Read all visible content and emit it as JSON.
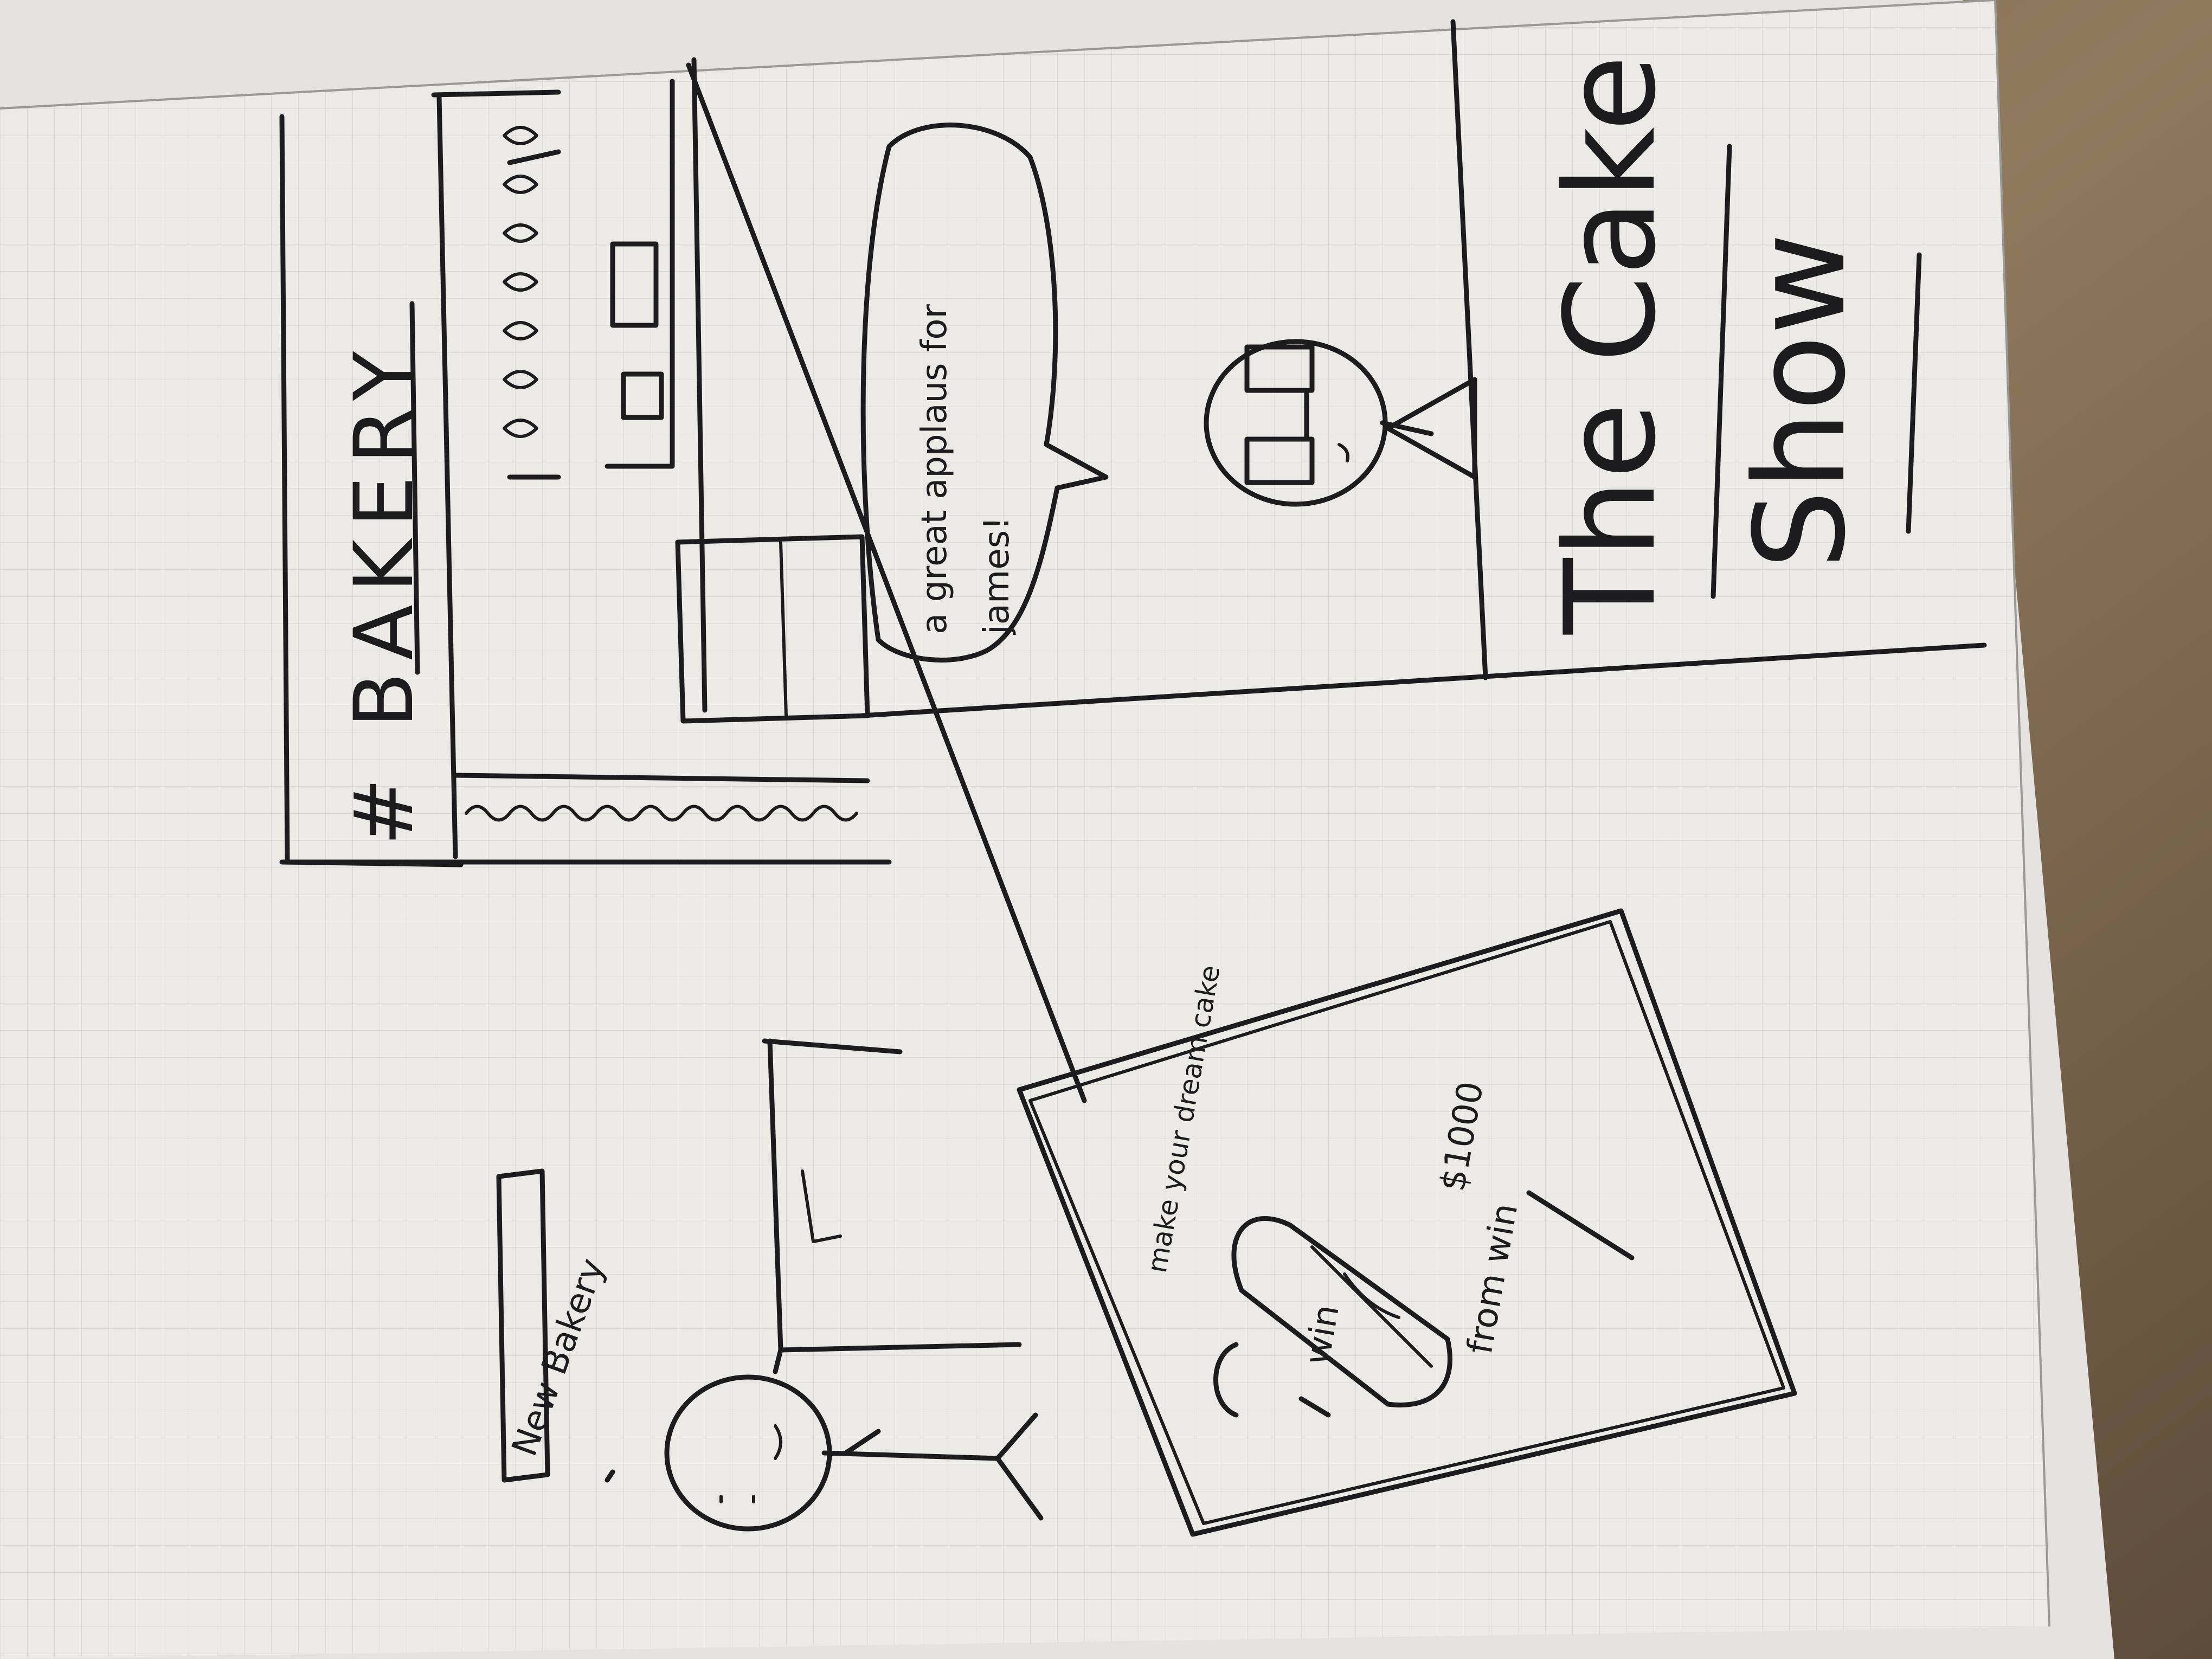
{
  "colors": {
    "paper": "#ebeae6",
    "desk": "#8a7558",
    "ink": "#1c1c1e",
    "grid": "#d9d8d4"
  },
  "panel_store": {
    "sign_text": "# BAKERY"
  },
  "panel_speech": {
    "bubble_line_1": "a great applaus for",
    "bubble_line_2": "james!"
  },
  "panel_title": {
    "line_1": "The Cake",
    "line_2": "Show"
  },
  "panel_street": {
    "sign_text": "New Bakery"
  },
  "panel_poster": {
    "line_1": "make your dream cake",
    "line_2": "$1000",
    "line_3": "win",
    "line_4": "from win"
  }
}
